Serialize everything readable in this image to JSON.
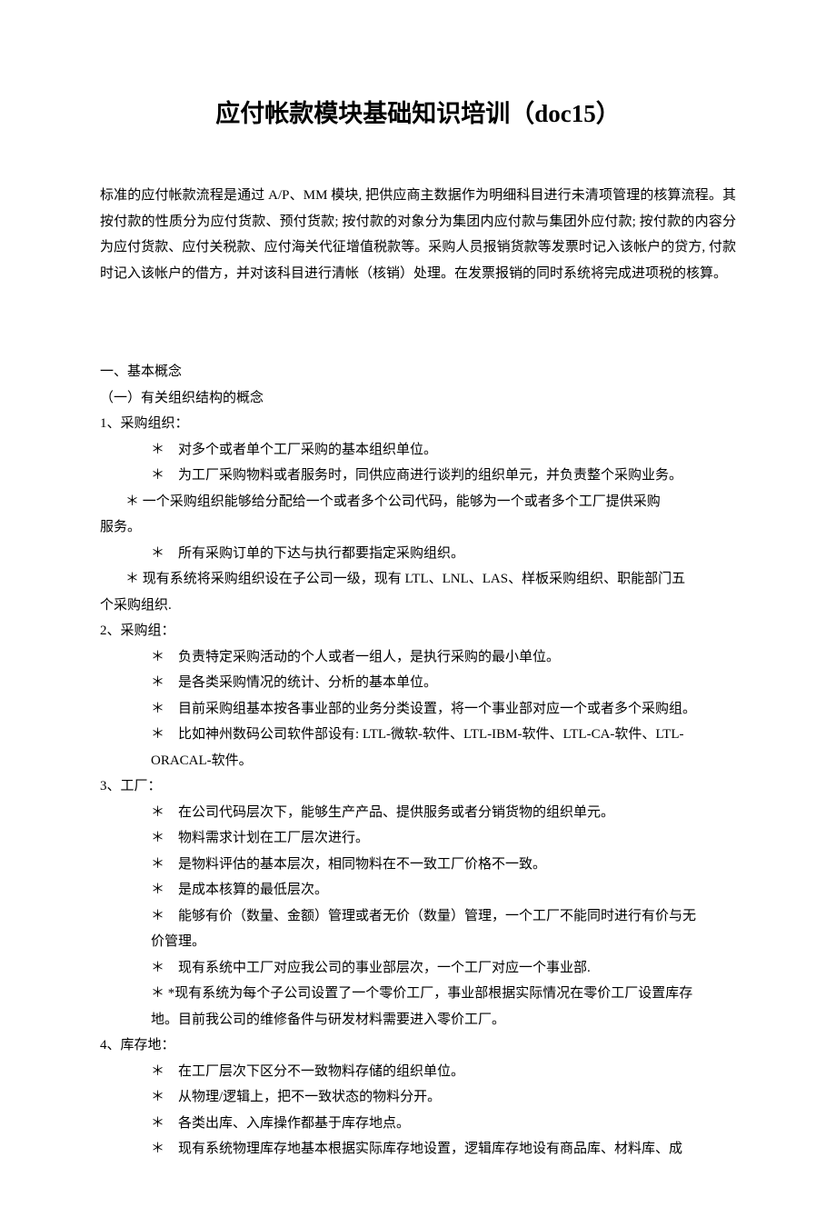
{
  "title_main": "应付帐款模块基础知识培训（",
  "title_doc": "doc15",
  "title_close": "）",
  "intro": "标准的应付帐款流程是通过 A/P、MM 模块, 把供应商主数据作为明细科目进行未清项管理的核算流程。其按付款的性质分为应付货款、预付货款; 按付款的对象分为集团内应付款与集团外应付款; 按付款的内容分为应付货款、应付关税款、应付海关代征增值税款等。采购人员报销货款等发票时记入该帐户的贷方, 付款时记入该帐户的借方，并对该科目进行清帐（核销）处理。在发票报销的同时系统将完成进项税的核算。",
  "s1": "一、基本概念",
  "s1_1": "（一）有关组织结构的概念",
  "i1": "1、采购组织：",
  "i1_b1": "＊　对多个或者单个工厂采购的基本组织单位。",
  "i1_b2": "＊　为工厂采购物料或者服务时，同供应商进行谈判的组织单元，并负责整个采购业务。",
  "i1_b3": "＊ 一个采购组织能够给分配给一个或者多个公司代码，能够为一个或者多个工厂提供采购",
  "i1_b3c": "服务。",
  "i1_b4": "＊　所有采购订单的下达与执行都要指定采购组织。",
  "i1_b5": "＊ 现有系统将采购组织设在子公司一级，现有 LTL、LNL、LAS、样板采购组织、职能部门五",
  "i1_b5c": "个采购组织.",
  "i2": "2、采购组：",
  "i2_b1": "＊　负责特定采购活动的个人或者一组人，是执行采购的最小单位。",
  "i2_b2": "＊　是各类采购情况的统计、分析的基本单位。",
  "i2_b3": "＊　目前采购组基本按各事业部的业务分类设置，将一个事业部对应一个或者多个采购组。",
  "i2_b4": "＊　比如神州数码公司软件部设有: LTL-微软-软件、LTL-IBM-软件、LTL-CA-软件、LTL-",
  "i2_b4c": "ORACAL-软件。",
  "i3": "3、工厂：",
  "i3_b1": "＊　在公司代码层次下，能够生产产品、提供服务或者分销货物的组织单元。",
  "i3_b2": "＊　物料需求计划在工厂层次进行。",
  "i3_b3": "＊　是物料评估的基本层次，相同物料在不一致工厂价格不一致。",
  "i3_b4": "＊　是成本核算的最低层次。",
  "i3_b5": "＊　能够有价（数量、金额）管理或者无价（数量）管理，一个工厂不能同时进行有价与无",
  "i3_b5c": "价管理。",
  "i3_b6": "＊　现有系统中工厂对应我公司的事业部层次，一个工厂对应一个事业部.",
  "i3_b7": "＊ *现有系统为每个子公司设置了一个零价工厂，事业部根据实际情况在零价工厂设置库存",
  "i3_b7c": "地。目前我公司的维修备件与研发材料需要进入零价工厂。",
  "i4": "4、库存地：",
  "i4_b1": "＊　在工厂层次下区分不一致物料存储的组织单位。",
  "i4_b2": "＊　从物理/逻辑上，把不一致状态的物料分开。",
  "i4_b3": "＊　各类出库、入库操作都基于库存地点。",
  "i4_b4": "＊　现有系统物理库存地基本根据实际库存地设置，逻辑库存地设有商品库、材料库、成"
}
